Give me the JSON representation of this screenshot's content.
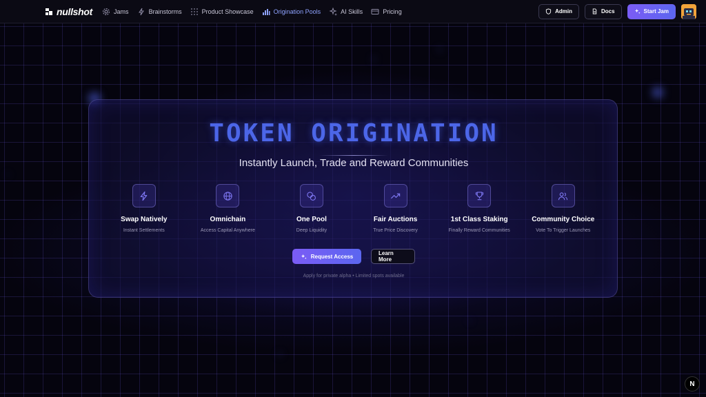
{
  "brand": {
    "name": "nullshot"
  },
  "nav": {
    "items": [
      {
        "label": "Jams",
        "icon": "gear-icon"
      },
      {
        "label": "Brainstorms",
        "icon": "bolt-icon"
      },
      {
        "label": "Product Showcase",
        "icon": "grid-dots-icon"
      },
      {
        "label": "Origination Pools",
        "icon": "bar-chart-icon"
      },
      {
        "label": "AI Skills",
        "icon": "sparkles-icon"
      },
      {
        "label": "Pricing",
        "icon": "card-icon"
      }
    ],
    "active_index": 3
  },
  "header": {
    "admin_label": "Admin",
    "docs_label": "Docs",
    "start_label": "Start Jam"
  },
  "hero": {
    "title": "Token Origination",
    "subtitle": "Instantly Launch, Trade and Reward Communities",
    "features": [
      {
        "title": "Swap Natively",
        "subtitle": "Instant Settlements",
        "icon": "bolt-icon"
      },
      {
        "title": "Omnichain",
        "subtitle": "Access Capital Anywhere",
        "icon": "globe-icon"
      },
      {
        "title": "One Pool",
        "subtitle": "Deep Liquidity",
        "icon": "coins-icon"
      },
      {
        "title": "Fair Auctions",
        "subtitle": "True Price Discovery",
        "icon": "trending-up-icon"
      },
      {
        "title": "1st Class Staking",
        "subtitle": "Finally Reward Communities",
        "icon": "trophy-icon"
      },
      {
        "title": "Community Choice",
        "subtitle": "Vote To Trigger Launches",
        "icon": "users-icon"
      }
    ],
    "request_label": "Request Access",
    "learn_label": "Learn More",
    "note": "Apply for private alpha • Limited spots available"
  },
  "badge": {
    "label": "N"
  },
  "colors": {
    "accent": "#6b63f2",
    "title": "#4c66e8",
    "active_nav": "#8fa3ff"
  }
}
